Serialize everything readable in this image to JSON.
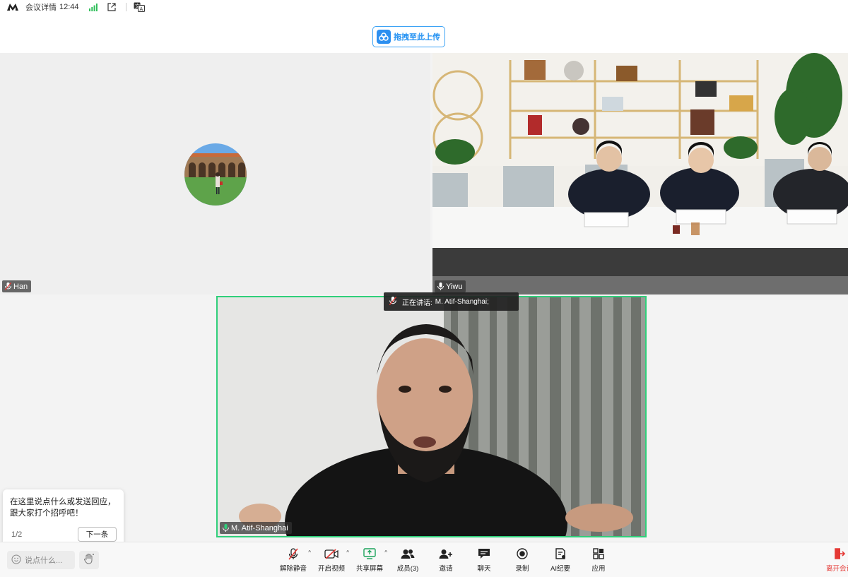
{
  "topbar": {
    "meeting_details": "会议详情",
    "time": "12:44"
  },
  "upload": {
    "label": "拖拽至此上传"
  },
  "participants": {
    "han": "Han",
    "yiwu": "Yiwu",
    "atif": "M. Atif-Shanghai"
  },
  "speaking": {
    "label": "正在讲话:",
    "name": "M. Atif-Shanghai;"
  },
  "chat_tip": {
    "message": "在这里说点什么或发送回应，跟大家打个招呼吧！",
    "counter": "1/2",
    "next_label": "下一条"
  },
  "bottom": {
    "say_placeholder": "说点什么...",
    "tools": [
      {
        "label": "解除静音"
      },
      {
        "label": "开启视频"
      },
      {
        "label": "共享屏幕"
      },
      {
        "label": "成员(3)"
      },
      {
        "label": "邀请"
      },
      {
        "label": "聊天"
      },
      {
        "label": "录制"
      },
      {
        "label": "AI纪要"
      },
      {
        "label": "应用"
      }
    ],
    "leave_label": "离开会议"
  },
  "colors": {
    "accent": "#1f8ff2",
    "speaker_border": "#2fcf7a",
    "leave": "#e53935"
  }
}
